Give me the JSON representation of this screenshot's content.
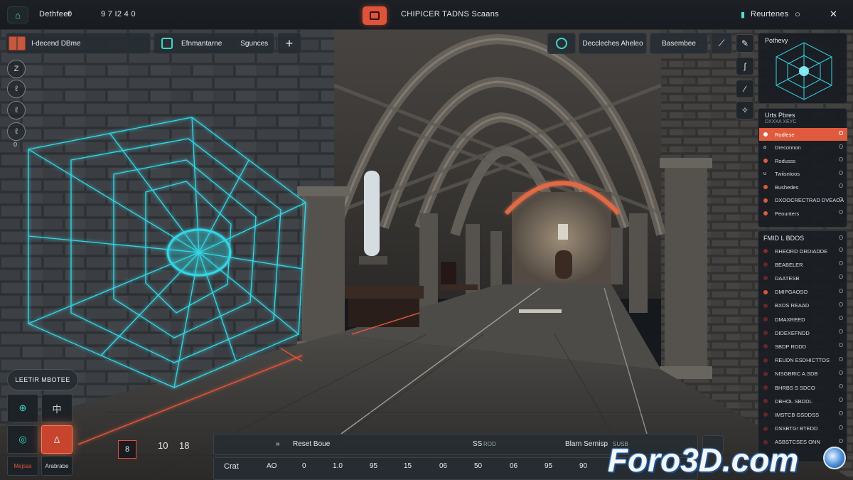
{
  "topbar": {
    "left_title": "Dethfeer",
    "left_num": "0",
    "left_status": "9 7 I2 4 0",
    "app_title": "CHIPICER TADNS Scaans",
    "right_label": "Reurtenes",
    "right_icon_glyph": "○",
    "close_glyph": "✕"
  },
  "toolbar": {
    "scene_label": "I-decend DBme",
    "tab1_label": "Efnmantarne",
    "tab2_label": "Sgunces",
    "add_label": "+",
    "search_label": "Deccleches Aheleo",
    "button_label": "Basembee"
  },
  "left_tools": [
    "Z",
    "ℓ",
    "ℓ",
    "ℓ"
  ],
  "left_zero": "0",
  "right_panel": {
    "preview_title": "Pothevy",
    "layers_title": "Urts Pbres",
    "layers_sub": "DXXXA XEYC",
    "layers": [
      {
        "label": "Rodlese",
        "marker": "",
        "color": "#e05a3e",
        "active": true
      },
      {
        "label": "Dreconnon",
        "marker": "a",
        "color": "",
        "active": false
      },
      {
        "label": "Rodusss",
        "marker": "",
        "color": "#e05a3e",
        "active": false
      },
      {
        "label": "Twiisntoos",
        "marker": "u",
        "color": "",
        "active": false
      },
      {
        "label": "Bushedes",
        "marker": "",
        "color": "#e05a3e",
        "active": false
      },
      {
        "label": "DXOOCRECTRAD DVEAOA",
        "marker": "",
        "color": "#e05a3e",
        "active": false
      },
      {
        "label": "Peounters",
        "marker": "",
        "color": "#e05a3e",
        "active": false
      }
    ],
    "list_title": "FMID L BDOS",
    "list": [
      {
        "label": "RHEORD ORDIADDE",
        "color": "#8a2a2a"
      },
      {
        "label": "BEABELER",
        "color": "#6a2626"
      },
      {
        "label": "DAATESB",
        "color": "#6a2626"
      },
      {
        "label": "DMIPGAOSO",
        "color": "#e0533a"
      },
      {
        "label": "BXDS REAAD",
        "color": "#6a2626"
      },
      {
        "label": "DMAXREED",
        "color": "#6a2626"
      },
      {
        "label": "DIDEXEFNDD",
        "color": "#6a2626"
      },
      {
        "label": "SBDP RDDD",
        "color": "#6a2626"
      },
      {
        "label": "REUDN ESDHICTTOS",
        "color": "#6a2626"
      },
      {
        "label": "NISGBRIC A.SDB",
        "color": "#6a2626"
      },
      {
        "label": "BHRBS S SDCO",
        "color": "#6a2626"
      },
      {
        "label": "DBHOL SBDDL",
        "color": "#6a2626"
      },
      {
        "label": "IMSTCB GSDDSS",
        "color": "#6a2626"
      },
      {
        "label": "DSSBTG! BTEDD",
        "color": "#6a2626"
      },
      {
        "label": "ASBSTCSES ONN",
        "color": "#6a2626"
      }
    ]
  },
  "bottom_left": {
    "mode_label": "LEETIR MBOTEE",
    "tile1": "⊕",
    "tile2": "中",
    "tile3": "◎",
    "tile4": "Δ",
    "label1": "Mejsas",
    "label2": "Arabrabe"
  },
  "timeline": {
    "frame_box": "8",
    "num1": "10",
    "num2": "18",
    "arrow": "»",
    "reset_label": "Reset Boue",
    "mid_label": "SS",
    "mid_dim": "ROD",
    "right_label": "Blarn Sernisp",
    "right_dim": "SUSB",
    "row2": [
      "Crat",
      "AO",
      "0",
      "1.0",
      "95",
      "15",
      "06",
      "50",
      "06",
      "95",
      "90"
    ]
  },
  "watermark": "Foro3D.com",
  "colors": {
    "accent_teal": "#3ed8c6",
    "accent_orange": "#e05a3e",
    "panel_bg": "#1a1e23"
  }
}
